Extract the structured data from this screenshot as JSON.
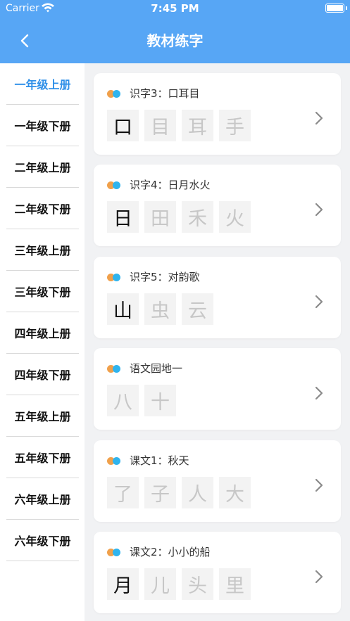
{
  "status_bar": {
    "carrier": "Carrier",
    "time": "7:45 PM"
  },
  "header": {
    "title": "教材练字",
    "back_icon": "chevron-left-icon"
  },
  "sidebar": {
    "active_index": 0,
    "items": [
      {
        "label": "一年级上册"
      },
      {
        "label": "一年级下册"
      },
      {
        "label": "二年级上册"
      },
      {
        "label": "二年级下册"
      },
      {
        "label": "三年级上册"
      },
      {
        "label": "三年级下册"
      },
      {
        "label": "四年级上册"
      },
      {
        "label": "四年级下册"
      },
      {
        "label": "五年级上册"
      },
      {
        "label": "五年级下册"
      },
      {
        "label": "六年级上册"
      },
      {
        "label": "六年级下册"
      }
    ]
  },
  "lessons": [
    {
      "title": "识字3：口耳目",
      "chars": [
        "口",
        "目",
        "耳",
        "手"
      ],
      "dark_count": 1
    },
    {
      "title": "识字4：日月水火",
      "chars": [
        "日",
        "田",
        "禾",
        "火"
      ],
      "dark_count": 1
    },
    {
      "title": "识字5：对韵歌",
      "chars": [
        "山",
        "虫",
        "云"
      ],
      "dark_count": 1
    },
    {
      "title": "语文园地一",
      "chars": [
        "八",
        "十"
      ],
      "dark_count": 0
    },
    {
      "title": "课文1：秋天",
      "chars": [
        "了",
        "子",
        "人",
        "大"
      ],
      "dark_count": 0
    },
    {
      "title": "课文2：小小的船",
      "chars": [
        "月",
        "儿",
        "头",
        "里"
      ],
      "dark_count": 1
    }
  ],
  "colors": {
    "header": "#57a6f5",
    "active": "#2e8fe8",
    "dot_orange": "#f0a04b",
    "dot_blue": "#2fb4ee"
  }
}
